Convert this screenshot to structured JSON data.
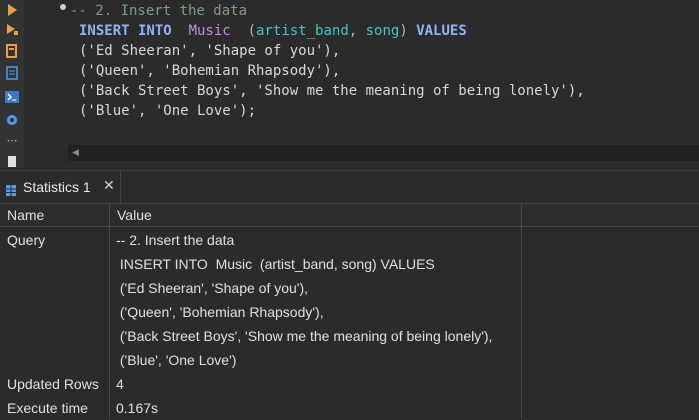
{
  "editor": {
    "lines": [
      {
        "segments": [
          {
            "t": "-- 2. Insert the data",
            "c": "cmt"
          }
        ]
      },
      {
        "segments": [
          {
            "t": "INSERT INTO",
            "c": "kw"
          },
          {
            "t": "  ",
            "c": ""
          },
          {
            "t": "Music",
            "c": "tbl"
          },
          {
            "t": "  (",
            "c": ""
          },
          {
            "t": "artist_band",
            "c": "col"
          },
          {
            "t": ", ",
            "c": ""
          },
          {
            "t": "song",
            "c": "col"
          },
          {
            "t": ") ",
            "c": ""
          },
          {
            "t": "VALUES",
            "c": "kw"
          }
        ]
      },
      {
        "segments": [
          {
            "t": "('Ed Sheeran', 'Shape of you'),",
            "c": "str"
          }
        ]
      },
      {
        "segments": [
          {
            "t": "('Queen', 'Bohemian Rhapsody'),",
            "c": "str"
          }
        ]
      },
      {
        "segments": [
          {
            "t": "('Back Street Boys', 'Show me the meaning of being lonely'),",
            "c": "str"
          }
        ]
      },
      {
        "segments": [
          {
            "t": "('Blue', 'One Love');",
            "c": "str"
          }
        ]
      }
    ]
  },
  "results": {
    "tab_label": "Statistics 1",
    "close_glyph": "✕",
    "columns": [
      "Name",
      "Value"
    ],
    "rows": [
      {
        "name": "Query",
        "value_lines": [
          "-- 2. Insert the data",
          " INSERT INTO  Music  (artist_band, song) VALUES",
          " ('Ed Sheeran', 'Shape of you'),",
          " ('Queen', 'Bohemian Rhapsody'),",
          " ('Back Street Boys', 'Show me the meaning of being lonely'),",
          " ('Blue', 'One Love')"
        ]
      },
      {
        "name": "Updated Rows",
        "value_lines": [
          "4"
        ]
      },
      {
        "name": "Execute time",
        "value_lines": [
          "0.167s"
        ]
      }
    ]
  },
  "gutter_icons": [
    "run-icon",
    "run-script-icon",
    "explain-icon",
    "script-icon",
    "terminal-icon",
    "settings-icon",
    "more-icon",
    "file-icon"
  ]
}
